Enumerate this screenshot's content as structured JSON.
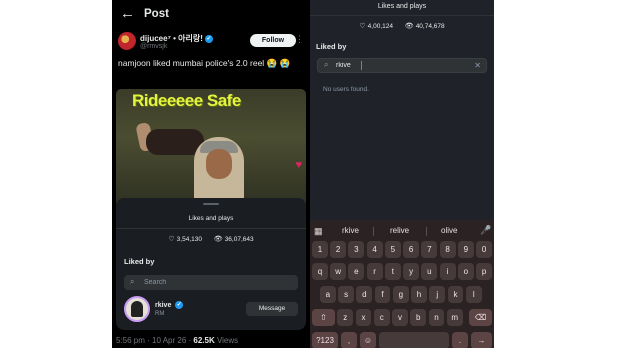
{
  "left_post": {
    "header_title": "Post",
    "author": {
      "name": "dijucee⁷ • 아리랑!",
      "handle": "@rmvsjk",
      "follow_label": "Follow"
    },
    "post_text": "namjoon liked mumbai police's 2.0 reel",
    "post_emoji": "😭",
    "media_caption": "Rideeeee Safe",
    "likes_sheet": {
      "title": "Likes and plays",
      "likes": "3,54,130",
      "plays": "36,07,643",
      "liked_by_label": "Liked by",
      "search_placeholder": "Search",
      "user": {
        "name": "rkive",
        "subtitle": "RM",
        "message_label": "Message"
      }
    },
    "footer": {
      "time_date": "5:56 pm · 10 Apr 26 · ",
      "views_count": "62.5K",
      "views_label": " Views"
    }
  },
  "right_panel": {
    "title": "Likes and plays",
    "likes": "4,00,124",
    "plays": "40,74,678",
    "liked_by_label": "Liked by",
    "search_value": "rkive",
    "no_results": "No users found.",
    "keyboard": {
      "suggestions": [
        "rkive",
        "relive",
        "olive"
      ],
      "rows": [
        [
          "1",
          "2",
          "3",
          "4",
          "5",
          "6",
          "7",
          "8",
          "9",
          "0"
        ],
        [
          "q",
          "w",
          "e",
          "r",
          "t",
          "y",
          "u",
          "i",
          "o",
          "p"
        ],
        [
          "a",
          "s",
          "d",
          "f",
          "g",
          "h",
          "j",
          "k",
          "l"
        ],
        [
          "z",
          "x",
          "c",
          "v",
          "b",
          "n",
          "m"
        ],
        [
          "?123",
          ",",
          "☺",
          ".",
          "→"
        ]
      ],
      "colors": {
        "background": "#2b2223",
        "key": "#463a3b",
        "special_key": "#5c4445"
      }
    }
  },
  "colors": {
    "left_background": "#000000",
    "right_background": "#1f2329",
    "verified_blue": "#1d9bf0",
    "caption_yellow": "#e3f43f"
  }
}
